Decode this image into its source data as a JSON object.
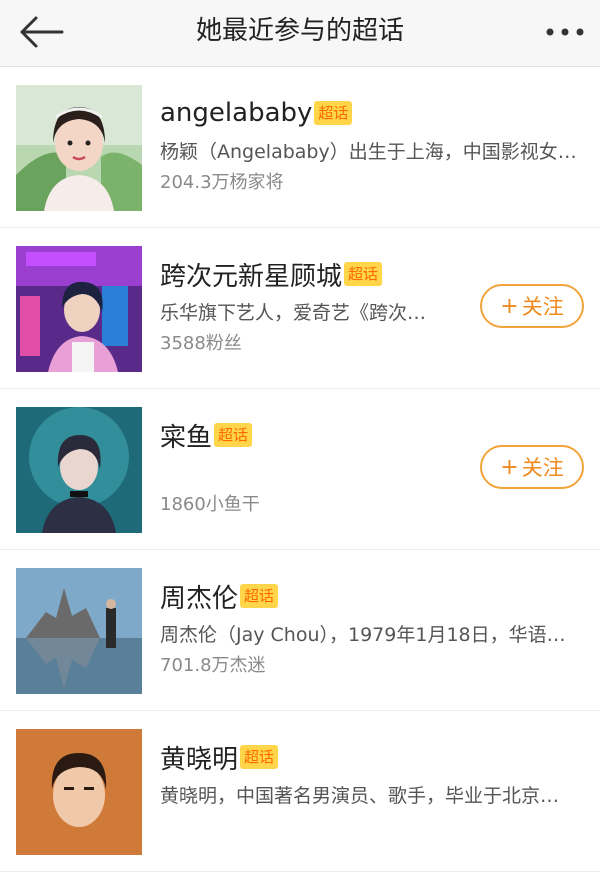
{
  "header": {
    "title": "她最近参与的超话",
    "back_icon": "arrow-left-icon",
    "more_icon": "more-dots-icon"
  },
  "items": [
    {
      "name": "angelababy",
      "badge": "超话",
      "desc": "杨颖（Angelababy）出生于上海，中国影视女…",
      "meta": "204.3万杨家将",
      "has_follow": false
    },
    {
      "name": "跨次元新星顾城",
      "badge": "超话",
      "desc": "乐华旗下艺人，爱奇艺《跨次…",
      "meta": "3588粉丝",
      "has_follow": true,
      "follow": {
        "plus": "+",
        "label": "关注"
      }
    },
    {
      "name": "寀鱼",
      "badge": "超话",
      "desc": "",
      "meta": "1860小鱼干",
      "has_follow": true,
      "follow": {
        "plus": "+",
        "label": "关注"
      }
    },
    {
      "name": "周杰伦",
      "badge": "超话",
      "desc": "周杰伦（Jay Chou），1979年1月18日，华语…",
      "meta": "701.8万杰迷",
      "has_follow": false
    },
    {
      "name": "黄晓明",
      "badge": "超话",
      "desc": "黄晓明，中国著名男演员、歌手，毕业于北京…",
      "meta": "",
      "has_follow": false
    }
  ],
  "colors": {
    "badge_bg": "#ffd54a",
    "badge_text": "#ff6a00",
    "follow_border": "#f2a33a",
    "follow_text": "#f08a1c"
  }
}
